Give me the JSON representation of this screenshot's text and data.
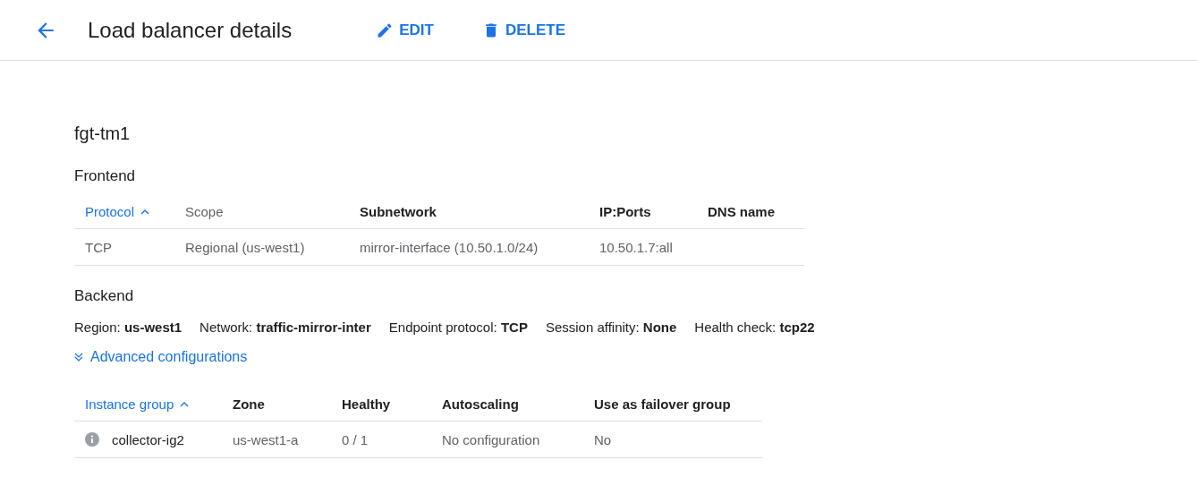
{
  "header": {
    "title": "Load balancer details",
    "actions": [
      {
        "kind": "edit",
        "label": "EDIT"
      },
      {
        "kind": "delete",
        "label": "DELETE"
      }
    ]
  },
  "name": "fgt-tm1",
  "frontend": {
    "heading": "Frontend",
    "columns": [
      {
        "label": "Protocol",
        "sorted": true,
        "bold": false
      },
      {
        "label": "Scope",
        "sorted": false,
        "bold": false
      },
      {
        "label": "Subnetwork",
        "sorted": false,
        "bold": true
      },
      {
        "label": "IP:Ports",
        "sorted": false,
        "bold": true
      },
      {
        "label": "DNS name",
        "sorted": false,
        "bold": true
      }
    ],
    "rows": [
      [
        "TCP",
        "Regional (us-west1)",
        "mirror-interface (10.50.1.0/24)",
        "10.50.1.7:all",
        ""
      ]
    ]
  },
  "backend": {
    "heading": "Backend",
    "properties": [
      {
        "label": "Region:",
        "value": "us-west1"
      },
      {
        "label": "Network:",
        "value": "traffic-mirror-inter"
      },
      {
        "label": "Endpoint protocol:",
        "value": "TCP"
      },
      {
        "label": "Session affinity:",
        "value": "None"
      },
      {
        "label": "Health check:",
        "value": "tcp22"
      }
    ],
    "advanced": {
      "label": "Advanced configurations",
      "expanded": false
    },
    "columns": [
      {
        "label": "Instance group",
        "sorted": true,
        "bold": false
      },
      {
        "label": "Zone",
        "sorted": false,
        "bold": true
      },
      {
        "label": "Healthy",
        "sorted": false,
        "bold": true
      },
      {
        "label": "Autoscaling",
        "sorted": false,
        "bold": true
      },
      {
        "label": "Use as failover group",
        "sorted": false,
        "bold": true
      }
    ],
    "rows": [
      [
        "collector-ig2",
        "us-west1-a",
        "0 / 1",
        "No configuration",
        "No"
      ]
    ]
  }
}
